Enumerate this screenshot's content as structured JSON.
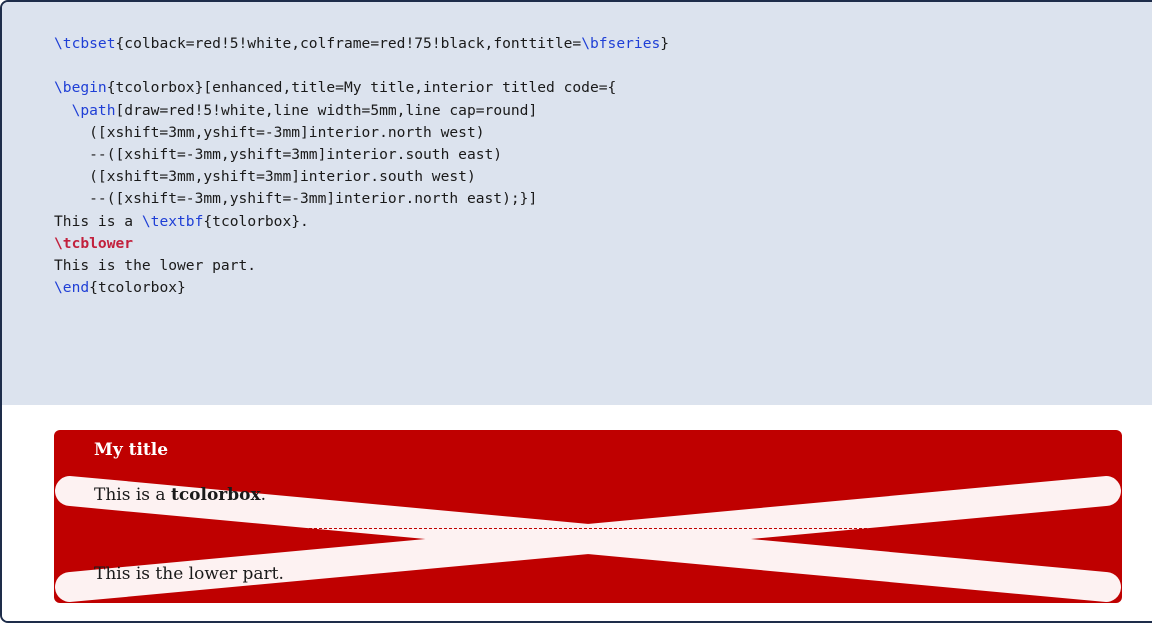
{
  "code": {
    "lines": [
      [
        {
          "t": "\\tcbset",
          "c": "kw"
        },
        {
          "t": "{colback=red!5!white,colframe=red!75!black,fonttitle="
        },
        {
          "t": "\\bfseries",
          "c": "kw"
        },
        {
          "t": "}"
        }
      ],
      [],
      [
        {
          "t": "\\begin",
          "c": "kw"
        },
        {
          "t": "{tcolorbox}[enhanced,title=My title,interior titled code={"
        }
      ],
      [
        {
          "t": "  "
        },
        {
          "t": "\\path",
          "c": "kw"
        },
        {
          "t": "[draw=red!5!white,line width=5mm,line cap=round]"
        }
      ],
      [
        {
          "t": "    ([xshift=3mm,yshift=-3mm]interior.north west)"
        }
      ],
      [
        {
          "t": "    --([xshift=-3mm,yshift=3mm]interior.south east)"
        }
      ],
      [
        {
          "t": "    ([xshift=3mm,yshift=3mm]interior.south west)"
        }
      ],
      [
        {
          "t": "    --([xshift=-3mm,yshift=-3mm]interior.north east);}]"
        }
      ],
      [
        {
          "t": "This is a "
        },
        {
          "t": "\\textbf",
          "c": "kw"
        },
        {
          "t": "{tcolorbox}."
        }
      ],
      [
        {
          "t": "\\tcblower",
          "c": "kw2"
        }
      ],
      [
        {
          "t": "This is the lower part."
        }
      ],
      [
        {
          "t": "\\end",
          "c": "kw"
        },
        {
          "t": "{tcolorbox}"
        }
      ]
    ]
  },
  "demo": {
    "title": "My title",
    "upper_prefix": "This is a ",
    "upper_bold": "tcolorbox",
    "upper_suffix": ".",
    "lower": "This is the lower part."
  },
  "colors": {
    "frame": "#1e2d4a",
    "code_background": "#dce3ee",
    "keyword": "#1f3fd6",
    "lower_keyword": "#c2213d",
    "box_frame": "#bf0000",
    "box_interior": "#fdf2f2"
  }
}
